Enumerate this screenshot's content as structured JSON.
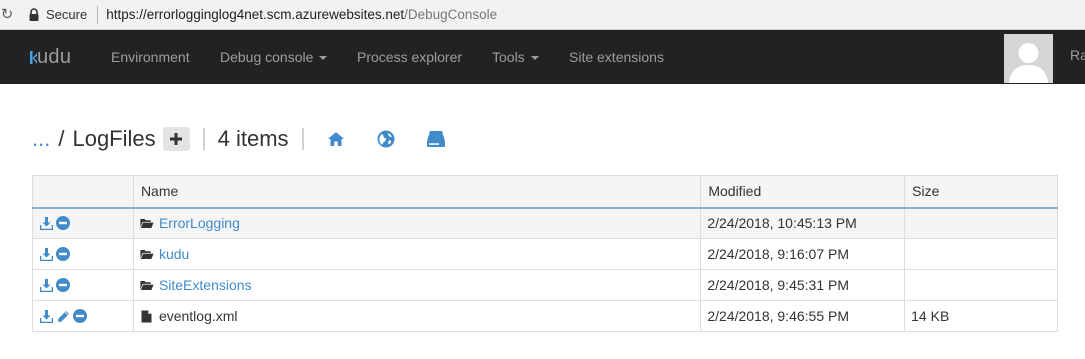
{
  "browser": {
    "secure_label": "Secure",
    "url_host": "https://errorlogginglog4net.scm.azurewebsites.net",
    "url_path": "/DebugConsole"
  },
  "navbar": {
    "brand": "Kudu",
    "items": [
      {
        "label": "Environment",
        "dropdown": false
      },
      {
        "label": "Debug console",
        "dropdown": true
      },
      {
        "label": "Process explorer",
        "dropdown": false
      },
      {
        "label": "Tools",
        "dropdown": true
      },
      {
        "label": "Site extensions",
        "dropdown": false
      }
    ],
    "user_name": "Ra"
  },
  "toolbar": {
    "parent_link": "...",
    "separator": "/",
    "current_folder": "LogFiles",
    "item_count": "4 items"
  },
  "table": {
    "headers": {
      "name": "Name",
      "modified": "Modified",
      "size": "Size"
    },
    "rows": [
      {
        "name": "ErrorLogging",
        "type": "folder",
        "modified": "2/24/2018, 10:45:13 PM",
        "size": "",
        "actions": [
          "download-icon",
          "delete-icon"
        ]
      },
      {
        "name": "kudu",
        "type": "folder",
        "modified": "2/24/2018, 9:16:07 PM",
        "size": "",
        "actions": [
          "download-icon",
          "delete-icon"
        ]
      },
      {
        "name": "SiteExtensions",
        "type": "folder",
        "modified": "2/24/2018, 9:45:31 PM",
        "size": "",
        "actions": [
          "download-icon",
          "delete-icon"
        ]
      },
      {
        "name": "eventlog.xml",
        "type": "file",
        "modified": "2/24/2018, 9:46:55 PM",
        "size": "14 KB",
        "actions": [
          "download-icon",
          "edit-icon",
          "delete-icon"
        ]
      }
    ]
  },
  "colors": {
    "accent": "#428bca",
    "navbar_bg": "#222222",
    "nav_text": "#9d9d9d"
  }
}
